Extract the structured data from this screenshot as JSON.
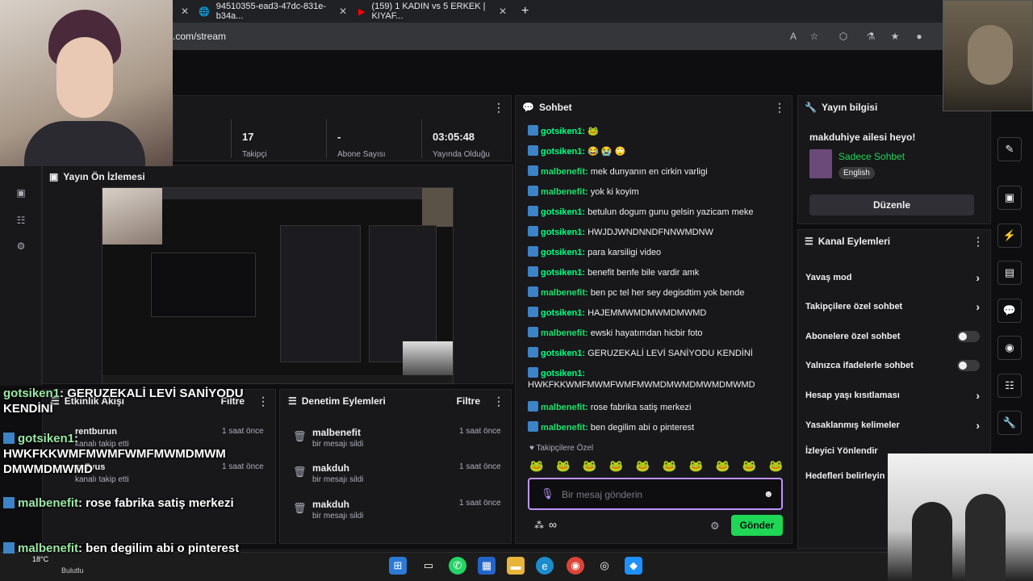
{
  "browser": {
    "tabs": [
      {
        "label": "94510355-ead3-47dc-831e-b34a..."
      },
      {
        "label": "(159) 1 KADIN vs 5 ERKEK | KIYAF..."
      }
    ],
    "url": ".com/stream"
  },
  "stats": {
    "items": [
      {
        "value": "17",
        "label": "Takipçi"
      },
      {
        "value": "-",
        "label": "Abone Sayısı"
      },
      {
        "value": "03:05:48",
        "label": "Yayında Olduğu"
      }
    ]
  },
  "preview": {
    "title": "Yayın Ön İzlemesi"
  },
  "activity": {
    "title": "Etkinlik Akışı",
    "filter": "Filtre",
    "items": [
      {
        "user": "rentburun",
        "text": "kanalı takip etti",
        "time": "1 saat önce"
      },
      {
        "user": "ca7vus",
        "text": "kanalı takip etti",
        "time": "1 saat önce"
      }
    ]
  },
  "mod": {
    "title": "Denetim Eylemleri",
    "filter": "Filtre",
    "items": [
      {
        "user": "malbenefit",
        "text": "bir mesajı sildi",
        "time": "1 saat önce"
      },
      {
        "user": "makduh",
        "text": "bir mesajı sildi",
        "time": "1 saat önce"
      },
      {
        "user": "makduh",
        "text": "bir mesajı sildi",
        "time": "1 saat önce"
      }
    ]
  },
  "chat": {
    "title": "Sohbet",
    "messages": [
      {
        "user": "gotsiken1:",
        "text": "🐸"
      },
      {
        "user": "gotsiken1:",
        "text": "😂 😭 🙄"
      },
      {
        "user": "malbenefit:",
        "text": "mek dunyanın en cirkin varligi"
      },
      {
        "user": "malbenefit:",
        "text": "yok ki koyim"
      },
      {
        "user": "gotsiken1:",
        "text": "betulun dogum gunu gelsin yazicam meke"
      },
      {
        "user": "gotsiken1:",
        "text": "HWJDJWNDNNDFNNWMDNW"
      },
      {
        "user": "gotsiken1:",
        "text": "para karsiligi video"
      },
      {
        "user": "gotsiken1:",
        "text": "benefit benfe bile vardir amk"
      },
      {
        "user": "malbenefit:",
        "text": "ben pc tel her sey degisdtim yok bende"
      },
      {
        "user": "gotsiken1:",
        "text": "HAJEMMWMDMWMDMWMD"
      },
      {
        "user": "malbenefit:",
        "text": "ewski hayatımdan hicbir foto"
      },
      {
        "user": "gotsiken1:",
        "text": "GERUZEKALİ LEVİ SANİYODU KENDİNİ"
      },
      {
        "user": "gotsiken1:",
        "text": "HWKFKKWMFMWMFWMFMWMDMWMDMWMDMWMD"
      },
      {
        "user": "malbenefit:",
        "text": "rose fabrika satiş merkezi"
      },
      {
        "user": "malbenefit:",
        "text": "ben degilim abi o pinterest"
      }
    ],
    "mode_label": "Takipçilere Özel",
    "input_placeholder": "Bir mesaj gönderin",
    "send_label": "Gönder",
    "points": "∞"
  },
  "info": {
    "title": "Yayın bilgisi",
    "stream_title": "makduhiye ailesi heyo!",
    "category": "Sadece Sohbet",
    "language": "English",
    "edit_label": "Düzenle"
  },
  "actions": {
    "title": "Kanal Eylemleri",
    "rows": [
      {
        "label": "Yavaş mod",
        "kind": "chevron"
      },
      {
        "label": "Takipçilere özel sohbet",
        "kind": "chevron"
      },
      {
        "label": "Abonelere özel sohbet",
        "kind": "toggle"
      },
      {
        "label": "Yalnızca ifadelerle sohbet",
        "kind": "toggle"
      },
      {
        "label": "Hesap yaşı kısıtlaması",
        "kind": "chevron"
      },
      {
        "label": "Yasaklanmış kelimeler",
        "kind": "chevron"
      },
      {
        "label": "İzleyici Yönlendir",
        "kind": "none"
      },
      {
        "label": "Hedefleri belirleyin",
        "kind": "none"
      }
    ]
  },
  "overlay": {
    "lines": [
      {
        "user": "gotsiken1",
        "text": ": GERUZEKALİ LEVİ SANİYODU KENDİNİ"
      },
      {
        "user": "gotsiken1",
        "text": ": HWKFKKWMFMWMFWMFMWMDMWM DMWMDMWMD"
      },
      {
        "user": "malbenefit",
        "text": ": rose fabrika satiş merkezi"
      },
      {
        "user": "malbenefit",
        "text": ": ben degilim abi o pinterest"
      }
    ],
    "weather": "18°C",
    "weather_sub": "Bulutlu"
  },
  "colors": {
    "accent": "#bf94ff",
    "send": "#1fd655",
    "badge": "#3d83c7"
  }
}
